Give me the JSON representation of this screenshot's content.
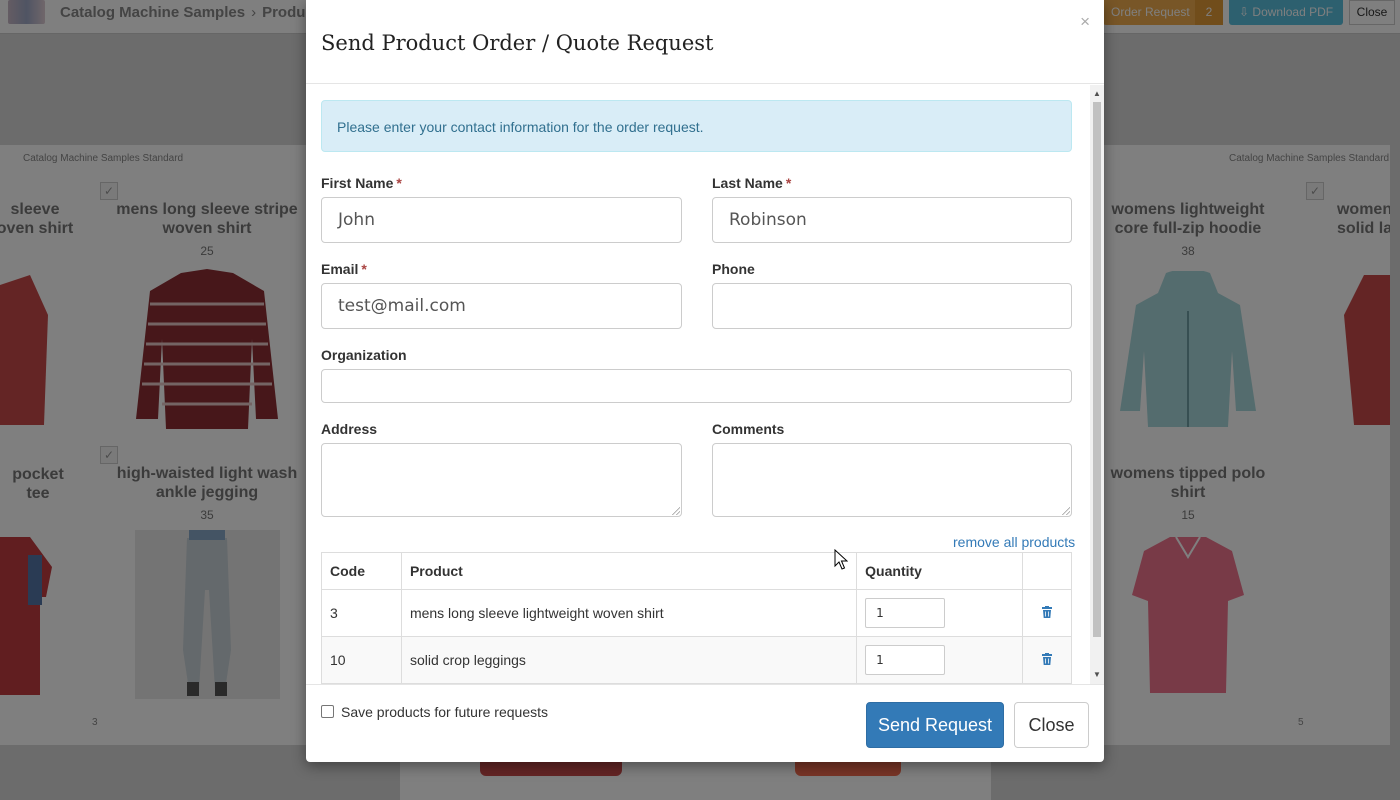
{
  "header": {
    "breadcrumb": [
      "Catalog Machine Samples",
      "Produc"
    ],
    "order_request_label": "Order Request",
    "order_request_count": "2",
    "download_pdf_label": "Download PDF",
    "close_label": "Close"
  },
  "catalog": {
    "brand": "Catalog Machine Samples Standard",
    "left_page": {
      "page_number": "3",
      "products": [
        {
          "title_line1": "sleeve",
          "title_line2": "oven shirt"
        },
        {
          "title_line1": "mens long sleeve stripe",
          "title_line2": "woven shirt",
          "code": "25"
        },
        {
          "title_line1": "pocket tee"
        },
        {
          "title_line1": "high-waisted light wash",
          "title_line2": "ankle jegging",
          "code": "35"
        }
      ]
    },
    "right_page": {
      "page_number": "5",
      "products": [
        {
          "title_line1": "womens lightweight",
          "title_line2": "core full-zip hoodie",
          "code": "38"
        },
        {
          "title_line1": "womens",
          "title_line2": "solid lay"
        },
        {
          "title_line1": "womens tipped polo",
          "title_line2": "shirt",
          "code": "15"
        }
      ]
    },
    "colors": {
      "shirt_red": "#c94b4b",
      "hoodie": "#a9d8dc",
      "polo": "#f0758f",
      "tee_red": "#c23c40",
      "tee_blue": "#5577a8"
    }
  },
  "modal": {
    "title": "Send Product Order / Quote Request",
    "close_x": "×",
    "alert": "Please enter your contact information for the order request.",
    "fields": {
      "first_name": {
        "label": "First Name",
        "required": "*",
        "value": "John"
      },
      "last_name": {
        "label": "Last Name",
        "required": "*",
        "value": "Robinson"
      },
      "email": {
        "label": "Email",
        "required": "*",
        "value": "test@mail.com"
      },
      "phone": {
        "label": "Phone",
        "value": ""
      },
      "organization": {
        "label": "Organization",
        "value": ""
      },
      "address": {
        "label": "Address",
        "value": ""
      },
      "comments": {
        "label": "Comments",
        "value": ""
      }
    },
    "remove_all": "remove all products",
    "table": {
      "columns": [
        "Code",
        "Product",
        "Quantity",
        ""
      ],
      "rows": [
        {
          "code": "3",
          "product": "mens long sleeve lightweight woven shirt",
          "quantity": "1"
        },
        {
          "code": "10",
          "product": "solid crop leggings",
          "quantity": "1"
        }
      ]
    },
    "save_products_label": "Save products for future requests",
    "send_button": "Send Request",
    "close_button": "Close"
  },
  "colors": {
    "primary": "#337ab7",
    "alert_bg": "#d9edf7",
    "alert_text": "#31708f",
    "required": "#a94442",
    "order_btn": "#f0ad4e",
    "pdf_btn": "#5bc0de"
  }
}
